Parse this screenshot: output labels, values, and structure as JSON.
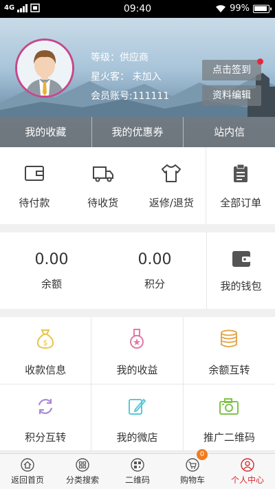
{
  "status_bar": {
    "network": "4G",
    "time": "09:40",
    "battery": "99%"
  },
  "profile": {
    "level": "等级：供应商",
    "star_member": "星火客： 未加入",
    "account": "会员账号:111111",
    "sign_in_label": "点击签到",
    "edit_label": "资料编辑"
  },
  "header_tabs": [
    "我的收藏",
    "我的优惠券",
    "站内信"
  ],
  "orders": [
    {
      "label": "待付款",
      "icon": "wallet-card-icon"
    },
    {
      "label": "待收货",
      "icon": "truck-icon"
    },
    {
      "label": "返修/退货",
      "icon": "return-shirt-icon"
    },
    {
      "label": "全部订单",
      "icon": "clipboard-icon"
    }
  ],
  "wallet": {
    "balance_value": "0.00",
    "balance_label": "余额",
    "points_value": "0.00",
    "points_label": "积分",
    "wallet_label": "我的钱包"
  },
  "services": [
    {
      "label": "收款信息",
      "icon": "money-bag-icon",
      "color": "#e8c547"
    },
    {
      "label": "我的收益",
      "icon": "medal-icon",
      "color": "#e27aa8"
    },
    {
      "label": "余额互转",
      "icon": "coins-icon",
      "color": "#e3a84e"
    },
    {
      "label": "积分互转",
      "icon": "refresh-icon",
      "color": "#a98bd6"
    },
    {
      "label": "我的微店",
      "icon": "edit-note-icon",
      "color": "#5bc8d6"
    },
    {
      "label": "推广二维码",
      "icon": "camera-icon",
      "color": "#7fc24a"
    }
  ],
  "tabbar": [
    {
      "label": "返回首页",
      "icon": "home-icon"
    },
    {
      "label": "分类搜索",
      "icon": "category-icon"
    },
    {
      "label": "二维码",
      "icon": "qrcode-icon"
    },
    {
      "label": "购物车",
      "icon": "cart-icon",
      "badge": "0"
    },
    {
      "label": "个人中心",
      "icon": "person-icon",
      "active": true
    }
  ],
  "colors": {
    "accent_red": "#d6282e",
    "avatar_ring": "#c4488a",
    "badge_orange": "#f07b1f"
  }
}
